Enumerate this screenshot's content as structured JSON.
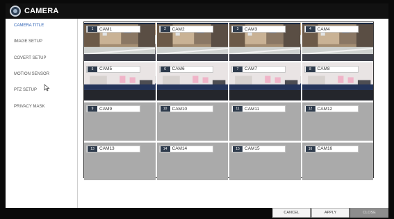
{
  "window": {
    "title": "CAMERA"
  },
  "sidebar": {
    "items": [
      {
        "label": "CAMERA TITLE",
        "active": true
      },
      {
        "label": "IMAGE SETUP",
        "active": false
      },
      {
        "label": "COVERT SETUP",
        "active": false
      },
      {
        "label": "MOTION SENSOR",
        "active": false
      },
      {
        "label": "PTZ SETUP",
        "active": false
      },
      {
        "label": "PRIVACY MASK",
        "active": false
      }
    ]
  },
  "cameras": [
    {
      "num": "1",
      "name": "CAM1",
      "feed": "live-a"
    },
    {
      "num": "2",
      "name": "CAM2",
      "feed": "live-a"
    },
    {
      "num": "3",
      "name": "CAM3",
      "feed": "live-a"
    },
    {
      "num": "4",
      "name": "CAM4",
      "feed": "live-a"
    },
    {
      "num": "5",
      "name": "CAM5",
      "feed": "live-b"
    },
    {
      "num": "6",
      "name": "CAM6",
      "feed": "live-b"
    },
    {
      "num": "7",
      "name": "CAM7",
      "feed": "live-b"
    },
    {
      "num": "8",
      "name": "CAM8",
      "feed": "live-b"
    },
    {
      "num": "9",
      "name": "CAM9",
      "feed": "none"
    },
    {
      "num": "10",
      "name": "CAM10",
      "feed": "none"
    },
    {
      "num": "11",
      "name": "CAM11",
      "feed": "none"
    },
    {
      "num": "12",
      "name": "CAM12",
      "feed": "none"
    },
    {
      "num": "13",
      "name": "CAM13",
      "feed": "none"
    },
    {
      "num": "14",
      "name": "CAM14",
      "feed": "none"
    },
    {
      "num": "15",
      "name": "CAM15",
      "feed": "none"
    },
    {
      "num": "16",
      "name": "CAM16",
      "feed": "none"
    }
  ],
  "buttons": {
    "cancel": "CANCEL",
    "apply": "APPLY",
    "close": "CLOSE"
  },
  "colors": {
    "accent": "#2d62b5",
    "titlebar": "#111111",
    "empty_channel": "#aaaaaa"
  }
}
